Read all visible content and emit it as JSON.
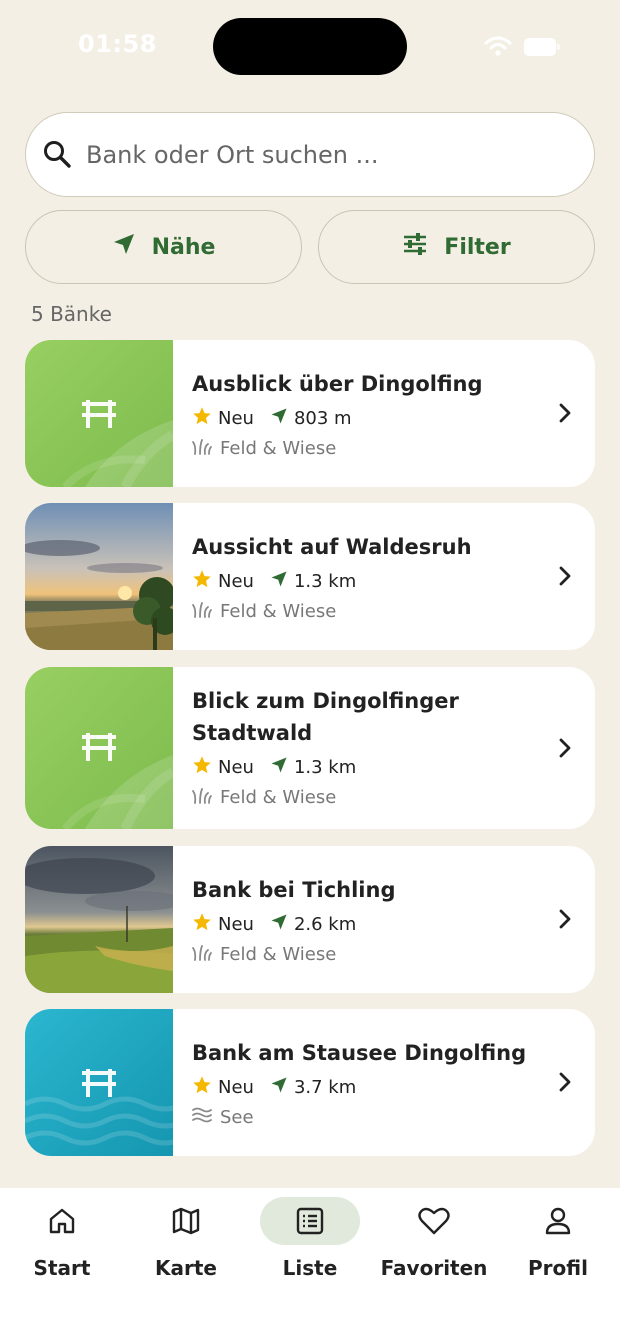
{
  "status": {
    "time": "01:58"
  },
  "search": {
    "placeholder": "Bank oder Ort suchen ..."
  },
  "actions": {
    "near_label": "Nähe",
    "filter_label": "Filter"
  },
  "results": {
    "count_label": "5 Bänke"
  },
  "benches": [
    {
      "title_lines": [
        "Ausblick über Dingolfing"
      ],
      "rating": "Neu",
      "distance": "803 m",
      "type": "Feld & Wiese",
      "thumb": "meadow-placeholder"
    },
    {
      "title_lines": [
        "Aussicht auf Waldesruh"
      ],
      "rating": "Neu",
      "distance": "1.3 km",
      "type": "Feld & Wiese",
      "thumb": "sunset-photo"
    },
    {
      "title_lines": [
        "Blick zum Dingolfinger",
        "Stadtwald"
      ],
      "rating": "Neu",
      "distance": "1.3 km",
      "type": "Feld & Wiese",
      "thumb": "meadow-placeholder"
    },
    {
      "title_lines": [
        "Bank bei Tichling"
      ],
      "rating": "Neu",
      "distance": "2.6 km",
      "type": "Feld & Wiese",
      "thumb": "field-photo"
    },
    {
      "title_lines": [
        "Bank am Stausee Dingolfing"
      ],
      "rating": "Neu",
      "distance": "3.7 km",
      "type": "See",
      "thumb": "lake-placeholder"
    }
  ],
  "nav": {
    "items": [
      {
        "label": "Start",
        "icon": "home-icon"
      },
      {
        "label": "Karte",
        "icon": "map-icon"
      },
      {
        "label": "Liste",
        "icon": "list-icon",
        "active": true
      },
      {
        "label": "Favoriten",
        "icon": "heart-icon"
      },
      {
        "label": "Profil",
        "icon": "person-icon"
      }
    ]
  },
  "colors": {
    "background": "#f4efe4",
    "accent_green": "#2f6b32",
    "star": "#f5b800",
    "nav_active": "#e1e8dc",
    "meadow_green": "#8cc659",
    "lake_teal": "#1fa8c2"
  }
}
